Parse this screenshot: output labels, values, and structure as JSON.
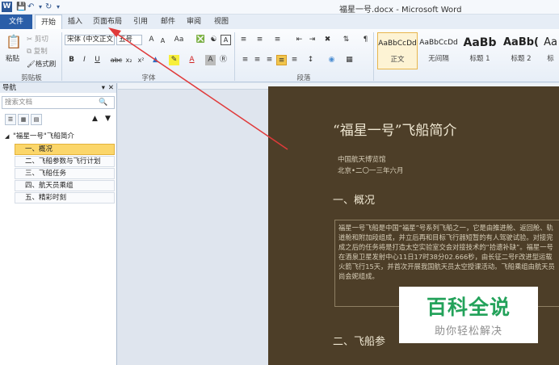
{
  "window": {
    "title": "福星一号.docx - Microsoft Word",
    "app_logo": "W"
  },
  "quick_access": [
    "save-icon",
    "undo-icon",
    "redo-icon"
  ],
  "tabs": [
    {
      "label": "文件"
    },
    {
      "label": "开始"
    },
    {
      "label": "插入"
    },
    {
      "label": "页面布局"
    },
    {
      "label": "引用"
    },
    {
      "label": "邮件"
    },
    {
      "label": "审阅"
    },
    {
      "label": "视图"
    }
  ],
  "clipboard": {
    "paste": "粘贴",
    "cut": "剪切",
    "copy": "复制",
    "format_painter": "格式刷",
    "group": "剪贴板"
  },
  "font": {
    "name": "宋体 (中文正文",
    "size": "五号",
    "group": "字体",
    "grow": "A",
    "shrink": "A",
    "case": "Aa",
    "bold": "B",
    "italic": "I",
    "underline": "U",
    "strike": "abc",
    "sub": "x₂",
    "sup": "x²",
    "color": "A"
  },
  "paragraph": {
    "group": "段落"
  },
  "styles": [
    {
      "preview": "AaBbCcDd",
      "name": "正文"
    },
    {
      "preview": "AaBbCcDd",
      "name": "无间隔"
    },
    {
      "preview": "AaBb",
      "name": "标题 1"
    },
    {
      "preview": "AaBb(",
      "name": "标题 2"
    },
    {
      "preview": "Aa",
      "name": "标"
    }
  ],
  "nav": {
    "header": "导航",
    "search_placeholder": "搜索文档",
    "root": "\"福星一号\"飞船简介",
    "items": [
      {
        "label": "一、概况",
        "selected": true
      },
      {
        "label": "二、飞船参数与飞行计划"
      },
      {
        "label": "三、飞船任务"
      },
      {
        "label": "四、航天员乘组"
      },
      {
        "label": "五、精彩时刻"
      }
    ]
  },
  "document": {
    "title": "“福星一号”飞船简介",
    "meta1": "中国航天博览馆",
    "meta2": "北京•二〇一三年六月",
    "h1": "一、概况",
    "body": "福星一号飞船是中国“福星”号系列飞船之一，它是由推进舱、返回舱、轨道舱和附加段组成，并立后再和目标飞行器短暂的有人驾驶试验。对接完成之后的任务将是打造太空实验室交会对接技术的“拾遗补缺”。福星一号在酒泉卫星发射中心11日17时38分02.666秒，由长征二号F改进型运载火箭飞行15天，并首次开展我国航天员太空授课活动。飞船乘组由航天员尚会妮组成。",
    "h2": "二、飞船参"
  },
  "watermark": {
    "big": "百科全说",
    "small": "助你轻松解决"
  }
}
